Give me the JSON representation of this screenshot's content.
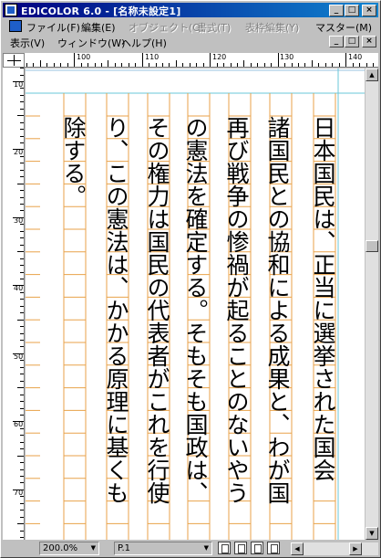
{
  "window": {
    "title": "EDICOLOR 6.0 - [名称未設定1]",
    "min_glyph": "_",
    "max_glyph": "□",
    "close_glyph": "×"
  },
  "menu": {
    "row1": [
      {
        "label": "ファイル(F)",
        "disabled": false
      },
      {
        "label": "編集(E)",
        "disabled": false
      },
      {
        "label": "オブジェクト(O)",
        "disabled": true
      },
      {
        "label": "書式(T)",
        "disabled": true
      },
      {
        "label": "表枠編集(Y)",
        "disabled": true
      },
      {
        "label": "マスター(M)",
        "disabled": false
      }
    ],
    "row2": [
      {
        "label": "表示(V)",
        "disabled": false
      },
      {
        "label": "ウィンドウ(W)",
        "disabled": false
      },
      {
        "label": "ヘルプ(H)",
        "disabled": false
      }
    ]
  },
  "ruler": {
    "h_labels": [
      "100",
      "110",
      "120",
      "130",
      "140"
    ],
    "v_labels": [
      "10",
      "20",
      "30",
      "40",
      "50",
      "60",
      "70"
    ]
  },
  "document": {
    "columns": [
      "日本国民は、正当に選挙された国会",
      "諸国民との協和による成果と、わが国",
      "再び戦争の惨禍が起ることのないやう",
      "の憲法を確定する。そもそも国政は、",
      "その権力は国民の代表者がこれを行使",
      "り、この憲法は、かかる原理に基くも",
      "除する。"
    ],
    "grid_color": "#e8a24a"
  },
  "status": {
    "zoom": "200.0%",
    "page": "P.1",
    "dropdown_glyph": "▼"
  }
}
